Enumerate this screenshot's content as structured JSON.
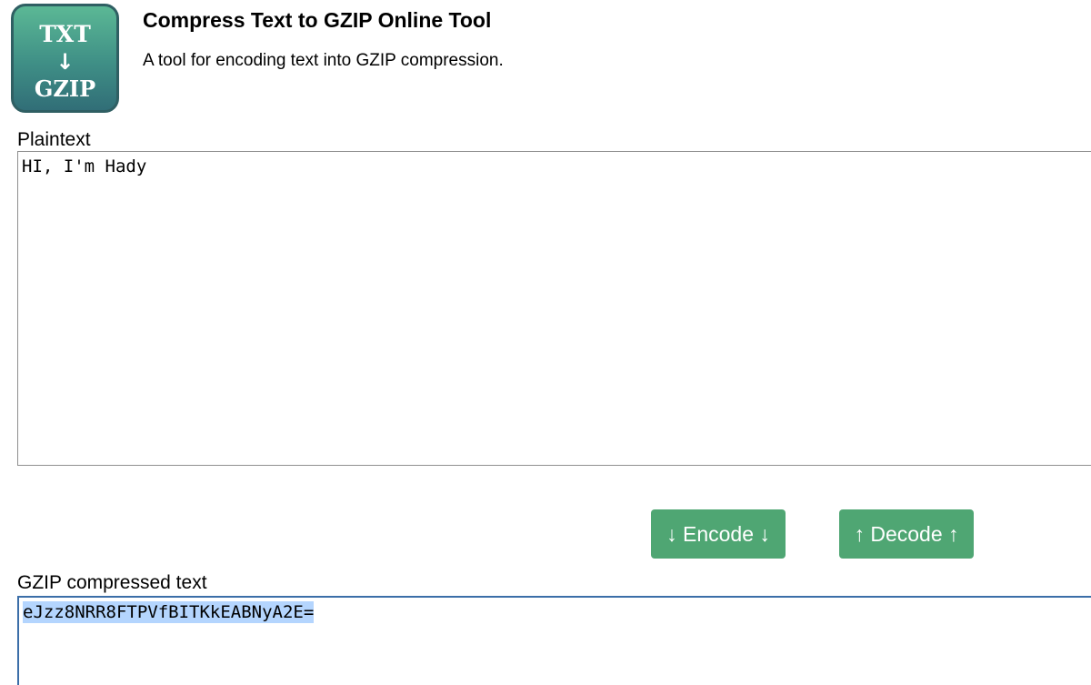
{
  "logo": {
    "line1": "TXT",
    "arrow": "↓",
    "line2": "GZIP"
  },
  "header": {
    "title": "Compress Text to GZIP Online Tool",
    "subtitle": "A tool for encoding text into GZIP compression."
  },
  "plaintext": {
    "label": "Plaintext",
    "value": "HI, I'm Hady"
  },
  "buttons": {
    "encode_label": "↓ Encode ↓",
    "decode_label": "↑ Decode ↑"
  },
  "gzip": {
    "label": "GZIP compressed text",
    "value": "eJzz8NRR8FTPVfBITKkEABNyA2E="
  },
  "colors": {
    "button_bg": "#4fa673",
    "logo_border": "#2f5f63",
    "focus_border": "#3b6ea8",
    "selection": "#b4d5fe"
  }
}
